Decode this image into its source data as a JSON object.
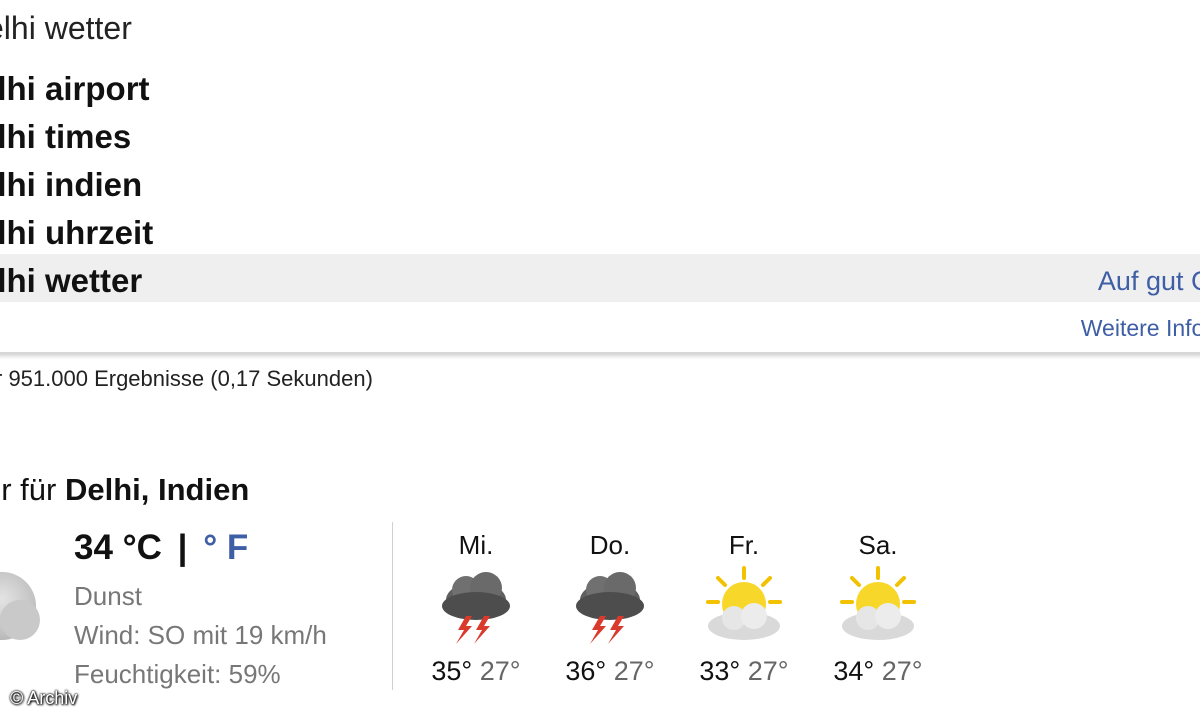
{
  "search": {
    "query": "elhi wetter"
  },
  "suggestions": [
    {
      "label": "elhi airport"
    },
    {
      "label": "elhi times"
    },
    {
      "label": "elhi indien"
    },
    {
      "label": "elhi uhrzeit"
    },
    {
      "label": "elhi wetter"
    }
  ],
  "links": {
    "lucky": "Auf gut G",
    "more_info": "Weitere Infor"
  },
  "result_stats": "r 951.000 Ergebnisse (0,17 Sekunden)",
  "weather": {
    "title_prefix": "er für",
    "title_location": "Delhi, Indien",
    "current": {
      "temp_c": "34 °C",
      "separator": "|",
      "unit_f": "° F",
      "condition": "Dunst",
      "wind": "Wind: SO mit 19 km/h",
      "humidity": "Feuchtigkeit: 59%",
      "icon": "haze-cloud-icon"
    },
    "forecast": [
      {
        "day": "Mi.",
        "high": "35°",
        "low": "27°",
        "icon": "thunderstorm-icon"
      },
      {
        "day": "Do.",
        "high": "36°",
        "low": "27°",
        "icon": "thunderstorm-icon"
      },
      {
        "day": "Fr.",
        "high": "33°",
        "low": "27°",
        "icon": "partly-sunny-icon"
      },
      {
        "day": "Sa.",
        "high": "34°",
        "low": "27°",
        "icon": "partly-sunny-icon"
      }
    ]
  },
  "watermark": "© Archiv",
  "colors": {
    "link": "#3e5ea5",
    "highlight": "#efefef",
    "muted": "#777777"
  }
}
